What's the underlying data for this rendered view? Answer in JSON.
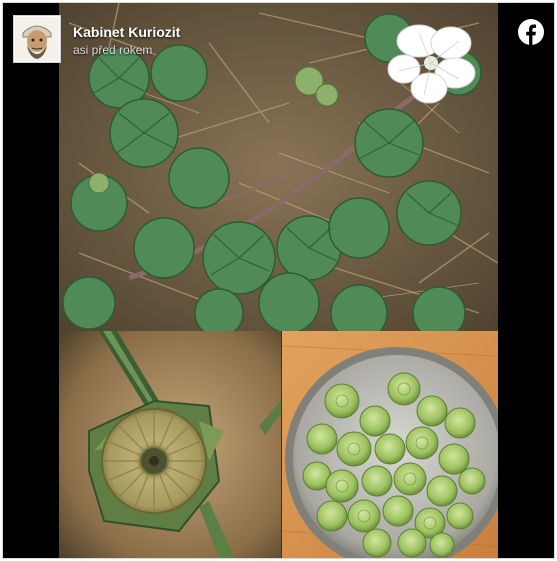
{
  "post": {
    "author": "Kabinet Kuriozit",
    "timestamp": "asi před rokem"
  },
  "icons": {
    "platform": "facebook-logo-icon",
    "avatar": "profile-avatar-illustration"
  },
  "colors": {
    "facebook_brand": "#ffffff",
    "backdrop": "#000000"
  }
}
